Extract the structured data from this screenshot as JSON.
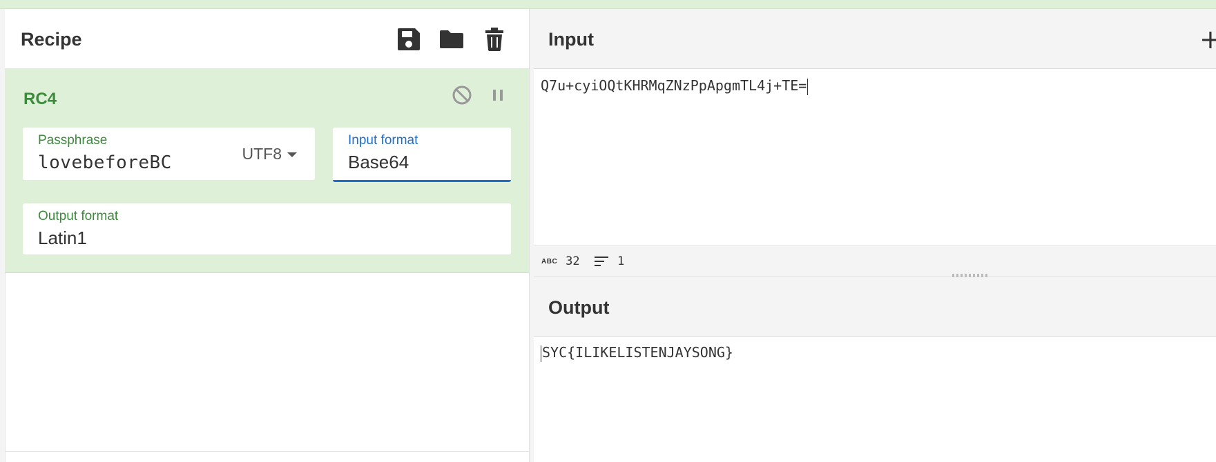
{
  "recipe": {
    "title": "Recipe",
    "icons": [
      "save-icon",
      "folder-icon",
      "trash-icon"
    ]
  },
  "operation": {
    "name": "RC4",
    "passphrase": {
      "label": "Passphrase",
      "value": "lovebeforeBC",
      "encoding": "UTF8"
    },
    "input_format": {
      "label": "Input format",
      "value": "Base64"
    },
    "output_format": {
      "label": "Output format",
      "value": "Latin1"
    }
  },
  "input": {
    "title": "Input",
    "text": "Q7u+cyiOQtKHRMqZNzPpApgmTL4j+TE=",
    "status": {
      "abc_label": "ABC",
      "length": "32",
      "lines": "1"
    }
  },
  "output": {
    "title": "Output",
    "text": "SYC{ILIKELISTENJAYSONG}"
  },
  "colors": {
    "operation_bg": "#dff0d8",
    "operation_label": "#3c8a3c",
    "focus_blue": "#1e6fcc"
  }
}
